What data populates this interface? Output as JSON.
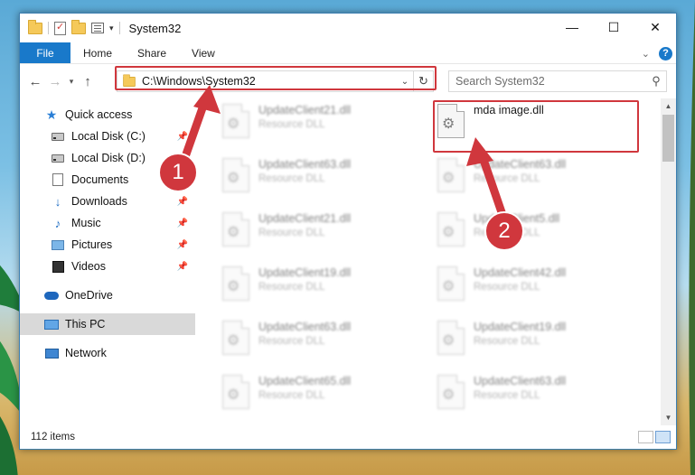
{
  "window": {
    "title": "System32",
    "controls": {
      "minimize": "—",
      "maximize": "☐",
      "close": "✕"
    }
  },
  "ribbon": {
    "tabs": [
      "File",
      "Home",
      "Share",
      "View"
    ],
    "help": "?"
  },
  "address": {
    "path": "C:\\Windows\\System32",
    "search_placeholder": "Search System32"
  },
  "nav": {
    "items": [
      {
        "label": "Quick access",
        "icon": "star-icon",
        "pinned": false
      },
      {
        "label": "Local Disk (C:)",
        "icon": "drive-icon",
        "pinned": true
      },
      {
        "label": "Local Disk (D:)",
        "icon": "drive-icon",
        "pinned": false
      },
      {
        "label": "Documents",
        "icon": "documents-icon",
        "pinned": true
      },
      {
        "label": "Downloads",
        "icon": "downloads-icon",
        "pinned": true
      },
      {
        "label": "Music",
        "icon": "music-icon",
        "pinned": true
      },
      {
        "label": "Pictures",
        "icon": "pictures-icon",
        "pinned": true
      },
      {
        "label": "Videos",
        "icon": "videos-icon",
        "pinned": true
      },
      {
        "label": "OneDrive",
        "icon": "onedrive-icon"
      },
      {
        "label": "This PC",
        "icon": "this-pc-icon",
        "selected": true
      },
      {
        "label": "Network",
        "icon": "network-icon"
      }
    ]
  },
  "files": {
    "left": [
      {
        "name": "UpdateClient21.dll",
        "type": "Resource DLL"
      },
      {
        "name": "UpdateClient63.dll",
        "type": "Resource DLL"
      },
      {
        "name": "UpdateClient21.dll",
        "type": "Resource DLL"
      },
      {
        "name": "UpdateClient19.dll",
        "type": "Resource DLL"
      },
      {
        "name": "UpdateClient63.dll",
        "type": "Resource DLL"
      },
      {
        "name": "UpdateClient65.dll",
        "type": "Resource DLL"
      }
    ],
    "right": [
      {
        "name": "mda image.dll",
        "type": ""
      },
      {
        "name": "UpdateClient63.dll",
        "type": "Resource DLL"
      },
      {
        "name": "UpdateClient5.dll",
        "type": "Resource DLL"
      },
      {
        "name": "UpdateClient42.dll",
        "type": "Resource DLL"
      },
      {
        "name": "UpdateClient19.dll",
        "type": "Resource DLL"
      },
      {
        "name": "UpdateClient63.dll",
        "type": "Resource DLL"
      }
    ]
  },
  "status": {
    "count": "112 items"
  },
  "callouts": {
    "step1": "1",
    "step2": "2"
  },
  "colors": {
    "accent": "#1979ca",
    "callout": "#d0373d"
  }
}
